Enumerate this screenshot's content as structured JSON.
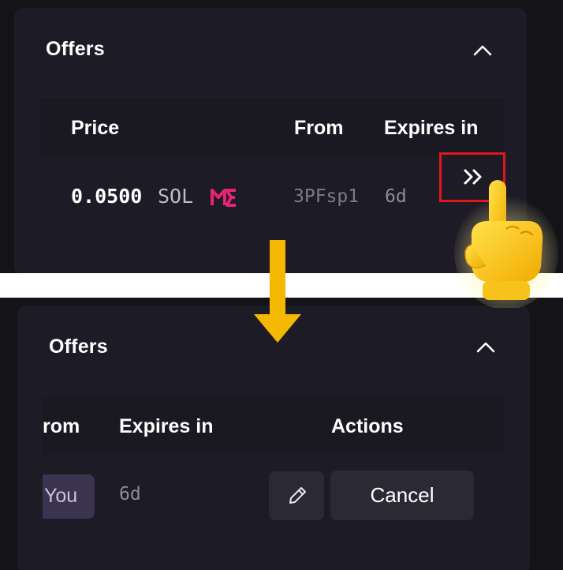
{
  "top_panel": {
    "title": "Offers",
    "headers": {
      "price": "Price",
      "from": "From",
      "expires": "Expires in"
    },
    "row": {
      "price_value": "0.0500",
      "price_unit": "SOL",
      "marketplace_icon": "magic-eden-logo",
      "from": "3PFsp1",
      "expires": "6d"
    },
    "expand_icon": "double-chevron-right-icon"
  },
  "bottom_panel": {
    "title": "Offers",
    "headers": {
      "from": "rom",
      "expires": "Expires in",
      "actions": "Actions"
    },
    "row": {
      "from": "You",
      "expires": "6d",
      "edit_icon": "pencil-icon",
      "cancel_label": "Cancel"
    }
  },
  "annotations": {
    "arrow_color": "#f5b800",
    "highlight_color": "#e0181c",
    "pointer_icon": "pointing-hand-icon"
  },
  "colors": {
    "background": "#141318",
    "card": "#1d1b25",
    "accent_pink": "#e42575"
  }
}
